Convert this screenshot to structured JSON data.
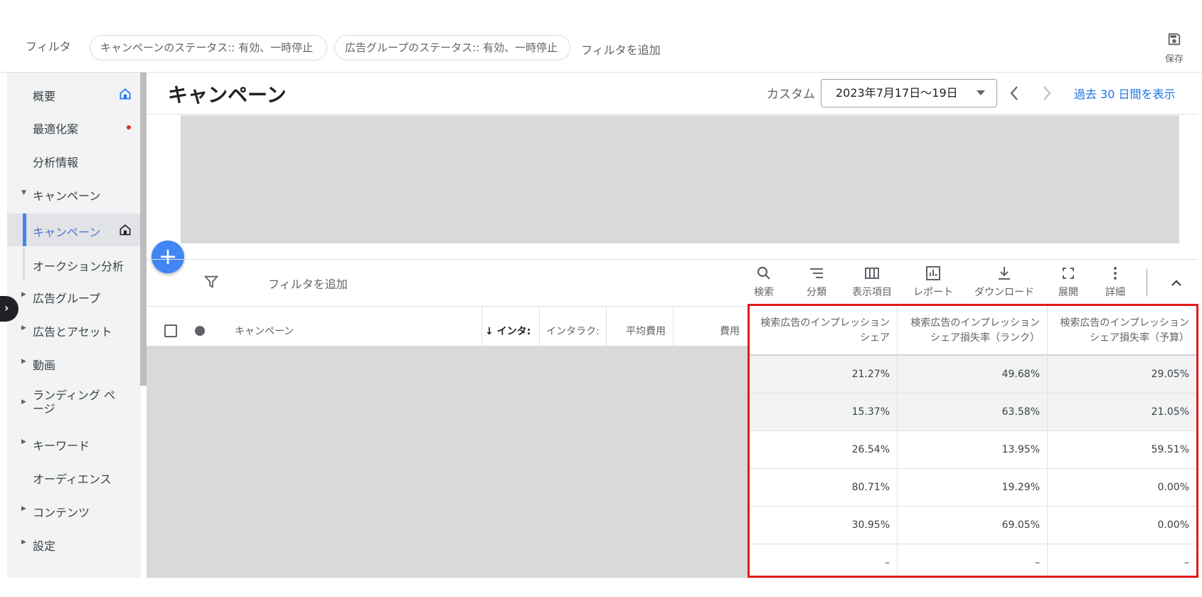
{
  "filter_bar": {
    "label": "フィルタ",
    "chips": [
      "キャンペーンのステータス:: 有効、一時停止",
      "広告グループのステータス:: 有効、一時停止"
    ],
    "add_filter": "フィルタを追加",
    "save_label": "保存"
  },
  "sidebar": {
    "items": [
      {
        "label": "概要"
      },
      {
        "label": "最適化案"
      },
      {
        "label": "分析情報"
      },
      {
        "label": "キャンペーン"
      },
      {
        "label": "キャンペーン"
      },
      {
        "label": "オークション分析"
      },
      {
        "label": "広告グループ"
      },
      {
        "label": "広告とアセット"
      },
      {
        "label": "動画"
      },
      {
        "label": "ランディング ページ"
      },
      {
        "label": "キーワード"
      },
      {
        "label": "オーディエンス"
      },
      {
        "label": "コンテンツ"
      },
      {
        "label": "設定"
      }
    ]
  },
  "header": {
    "title": "キャンペーン",
    "date_type": "カスタム",
    "date_range": "2023年7月17日〜19日",
    "past_30": "過去 30 日間を表示"
  },
  "toolbar": {
    "add_filter": "フィルタを追加",
    "search": "検索",
    "segment": "分類",
    "columns": "表示項目",
    "reports": "レポート",
    "download": "ダウンロード",
    "expand": "展開",
    "more": "詳細"
  },
  "table": {
    "headers": {
      "campaign": "キャンペーン",
      "interactions": "インタ:",
      "interaction_rate": "インタラク:",
      "avg_cost": "平均費用",
      "cost": "費用"
    },
    "metric_headers": [
      [
        "検索広告のインプレッション",
        "シェア"
      ],
      [
        "検索広告のインプレッション",
        "シェア損失率（ランク）"
      ],
      [
        "検索広告のインプレッション",
        "シェア損失率（予算）"
      ]
    ],
    "rows": [
      [
        "21.27%",
        "49.68%",
        "29.05%"
      ],
      [
        "15.37%",
        "63.58%",
        "21.05%"
      ],
      [
        "26.54%",
        "13.95%",
        "59.51%"
      ],
      [
        "80.71%",
        "19.29%",
        "0.00%"
      ],
      [
        "30.95%",
        "69.05%",
        "0.00%"
      ],
      [
        "–",
        "–",
        "–"
      ]
    ]
  },
  "colors": {
    "accent": "#1a73e8",
    "highlight_border": "#e01b1b",
    "fab": "#4285f4"
  }
}
